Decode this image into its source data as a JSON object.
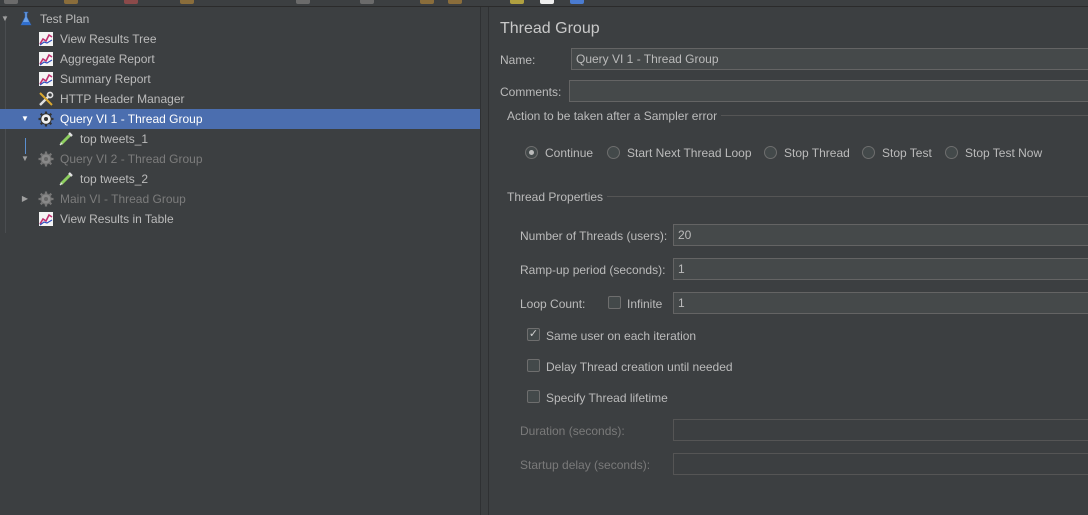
{
  "tree": {
    "items": [
      {
        "label": "Test Plan",
        "icon": "flask-icon"
      },
      {
        "label": "View Results Tree",
        "icon": "graph-icon"
      },
      {
        "label": "Aggregate Report",
        "icon": "graph-icon"
      },
      {
        "label": "Summary Report",
        "icon": "graph-icon"
      },
      {
        "label": "HTTP Header Manager",
        "icon": "wrench-icon"
      },
      {
        "label": "Query VI 1 - Thread Group",
        "icon": "gear-icon"
      },
      {
        "label": "top tweets_1",
        "icon": "pipette-icon"
      },
      {
        "label": "Query VI 2 - Thread Group",
        "icon": "gear-icon"
      },
      {
        "label": "top tweets_2",
        "icon": "pipette-icon"
      },
      {
        "label": "Main VI - Thread Group",
        "icon": "gear-icon"
      },
      {
        "label": "View Results in Table",
        "icon": "graph-icon"
      }
    ]
  },
  "panel": {
    "title": "Thread Group",
    "name_label": "Name:",
    "name_value": "Query VI 1 - Thread Group",
    "comments_label": "Comments:",
    "comments_value": "",
    "sampler_error": {
      "title": "Action to be taken after a Sampler error",
      "options": [
        "Continue",
        "Start Next Thread Loop",
        "Stop Thread",
        "Stop Test",
        "Stop Test Now"
      ],
      "selected": "Continue"
    },
    "thread_props": {
      "title": "Thread Properties",
      "threads_label": "Number of Threads (users):",
      "threads_value": "20",
      "rampup_label": "Ramp-up period (seconds):",
      "rampup_value": "1",
      "loop_label": "Loop Count:",
      "infinite_label": "Infinite",
      "loop_value": "1",
      "same_user_label": "Same user on each iteration",
      "delay_label": "Delay Thread creation until needed",
      "lifetime_label": "Specify Thread lifetime",
      "duration_label": "Duration (seconds):",
      "duration_value": "",
      "startup_label": "Startup delay (seconds):",
      "startup_value": ""
    }
  },
  "colors": {
    "background": "#3c3f41",
    "selection": "#4b6eaf",
    "text": "#bbbbbb"
  }
}
